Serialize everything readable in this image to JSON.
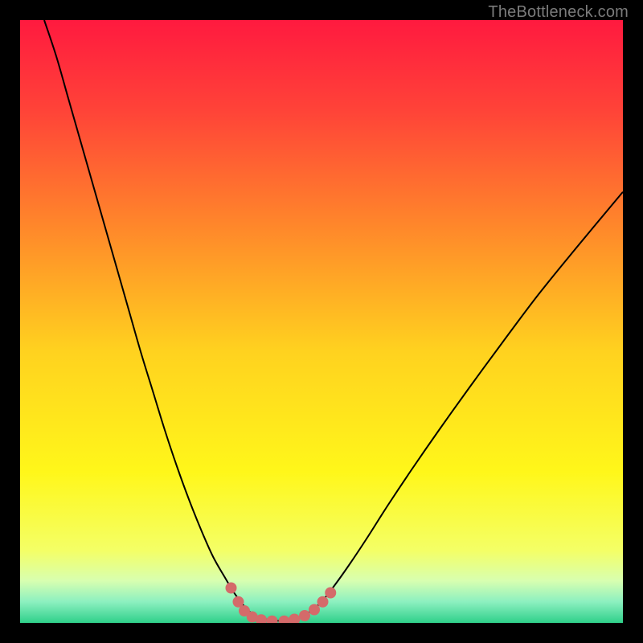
{
  "watermark": "TheBottleneck.com",
  "chart_data": {
    "type": "line",
    "title": "",
    "xlabel": "",
    "ylabel": "",
    "xlim": [
      0,
      1
    ],
    "ylim": [
      0,
      1
    ],
    "background": {
      "gradient_stops": [
        {
          "offset": 0.0,
          "color": "#ff1a3f"
        },
        {
          "offset": 0.15,
          "color": "#ff4338"
        },
        {
          "offset": 0.35,
          "color": "#ff8a2a"
        },
        {
          "offset": 0.55,
          "color": "#ffd21f"
        },
        {
          "offset": 0.75,
          "color": "#fff71a"
        },
        {
          "offset": 0.88,
          "color": "#f4ff66"
        },
        {
          "offset": 0.93,
          "color": "#d8ffb0"
        },
        {
          "offset": 0.965,
          "color": "#8cf0c0"
        },
        {
          "offset": 1.0,
          "color": "#2fd08a"
        }
      ]
    },
    "series": [
      {
        "name": "bottleneck-curve",
        "stroke": "#000000",
        "stroke_width": 2,
        "points": [
          {
            "x": 0.04,
            "y": 1.0
          },
          {
            "x": 0.06,
            "y": 0.94
          },
          {
            "x": 0.08,
            "y": 0.87
          },
          {
            "x": 0.1,
            "y": 0.8
          },
          {
            "x": 0.12,
            "y": 0.73
          },
          {
            "x": 0.14,
            "y": 0.66
          },
          {
            "x": 0.16,
            "y": 0.59
          },
          {
            "x": 0.18,
            "y": 0.52
          },
          {
            "x": 0.2,
            "y": 0.45
          },
          {
            "x": 0.22,
            "y": 0.385
          },
          {
            "x": 0.24,
            "y": 0.32
          },
          {
            "x": 0.26,
            "y": 0.26
          },
          {
            "x": 0.28,
            "y": 0.205
          },
          {
            "x": 0.3,
            "y": 0.155
          },
          {
            "x": 0.32,
            "y": 0.11
          },
          {
            "x": 0.34,
            "y": 0.075
          },
          {
            "x": 0.355,
            "y": 0.05
          },
          {
            "x": 0.37,
            "y": 0.03
          },
          {
            "x": 0.385,
            "y": 0.015
          },
          {
            "x": 0.4,
            "y": 0.008
          },
          {
            "x": 0.42,
            "y": 0.004
          },
          {
            "x": 0.44,
            "y": 0.004
          },
          {
            "x": 0.46,
            "y": 0.008
          },
          {
            "x": 0.48,
            "y": 0.018
          },
          {
            "x": 0.5,
            "y": 0.035
          },
          {
            "x": 0.52,
            "y": 0.06
          },
          {
            "x": 0.545,
            "y": 0.095
          },
          {
            "x": 0.575,
            "y": 0.14
          },
          {
            "x": 0.61,
            "y": 0.195
          },
          {
            "x": 0.65,
            "y": 0.255
          },
          {
            "x": 0.695,
            "y": 0.32
          },
          {
            "x": 0.745,
            "y": 0.39
          },
          {
            "x": 0.8,
            "y": 0.465
          },
          {
            "x": 0.86,
            "y": 0.545
          },
          {
            "x": 0.925,
            "y": 0.625
          },
          {
            "x": 1.0,
            "y": 0.715
          }
        ]
      },
      {
        "name": "marker-dots",
        "stroke": "#d46a6a",
        "marker_radius": 7,
        "points": [
          {
            "x": 0.35,
            "y": 0.058
          },
          {
            "x": 0.362,
            "y": 0.035
          },
          {
            "x": 0.372,
            "y": 0.02
          },
          {
            "x": 0.385,
            "y": 0.01
          },
          {
            "x": 0.4,
            "y": 0.005
          },
          {
            "x": 0.418,
            "y": 0.003
          },
          {
            "x": 0.438,
            "y": 0.003
          },
          {
            "x": 0.455,
            "y": 0.006
          },
          {
            "x": 0.472,
            "y": 0.012
          },
          {
            "x": 0.488,
            "y": 0.022
          },
          {
            "x": 0.502,
            "y": 0.035
          },
          {
            "x": 0.515,
            "y": 0.05
          }
        ]
      }
    ]
  }
}
